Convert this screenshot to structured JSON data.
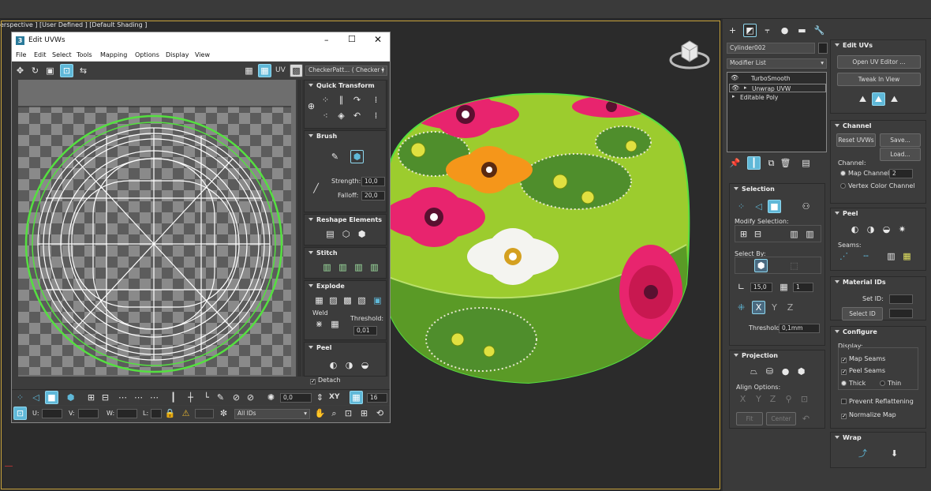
{
  "viewport": {
    "label": "erspective ] [User Defined ] [Default Shading ]"
  },
  "window": {
    "title": "Edit UVWs",
    "menu": [
      "File",
      "Edit",
      "Select",
      "Tools",
      "Mapping",
      "Options",
      "Display",
      "View"
    ],
    "texture_dropdown": "CheckerPatt... ( Checker )",
    "uv_label": "UV",
    "rollouts": {
      "quick_transform": "Quick Transform",
      "brush": "Brush",
      "strength_label": "Strength:",
      "strength_value": "10,0",
      "falloff_label": "Falloff:",
      "falloff_value": "20,0",
      "reshape": "Reshape Elements",
      "stitch": "Stitch",
      "explode": "Explode",
      "weld": "Weld",
      "threshold_label": "Threshold:",
      "threshold_value": "0,01",
      "peel": "Peel",
      "detach": "Detach"
    },
    "bottom": {
      "rotate_value": "0,0",
      "xy_label": "XY",
      "grid_value": "16",
      "u_label": "U:",
      "v_label": "V:",
      "w_label": "W:",
      "l_label": "L:",
      "ids_dropdown": "All IDs"
    }
  },
  "panel": {
    "object_name": "Cylinder002",
    "modifier_list": "Modifier List",
    "stack": [
      "TurboSmooth",
      "Unwrap UVW",
      "Editable Poly"
    ],
    "selection": {
      "title": "Selection",
      "modify_selection": "Modify Selection:",
      "select_by": "Select By:",
      "angle_value": "15,0",
      "count_value": "1",
      "threshold_label": "Threshold:",
      "threshold_value": "0,1mm"
    },
    "projection": {
      "title": "Projection",
      "align_options": "Align Options:",
      "fit": "Fit",
      "center": "Center"
    },
    "edit_uvs": {
      "title": "Edit UVs",
      "open_editor": "Open UV Editor ...",
      "tweak": "Tweak In View"
    },
    "channel": {
      "title": "Channel",
      "reset": "Reset UVWs",
      "save": "Save...",
      "load": "Load...",
      "channel_label": "Channel:",
      "map_channel": "Map Channel:",
      "map_channel_value": "2",
      "vertex_color": "Vertex Color Channel"
    },
    "peel": {
      "title": "Peel",
      "seams": "Seams:"
    },
    "material_ids": {
      "title": "Material IDs",
      "set_id": "Set ID:",
      "select_id": "Select ID"
    },
    "configure": {
      "title": "Configure",
      "display": "Display:",
      "map_seams": "Map Seams",
      "peel_seams": "Peel Seams",
      "thick": "Thick",
      "thin": "Thin",
      "prevent": "Prevent Reflattening",
      "normalize": "Normalize Map"
    },
    "wrap": {
      "title": "Wrap"
    }
  },
  "colors": {
    "accent": "#5fb8d8",
    "wire_green": "#55e040",
    "tin_green": "#9ccc2e",
    "pink": "#e8246e"
  }
}
